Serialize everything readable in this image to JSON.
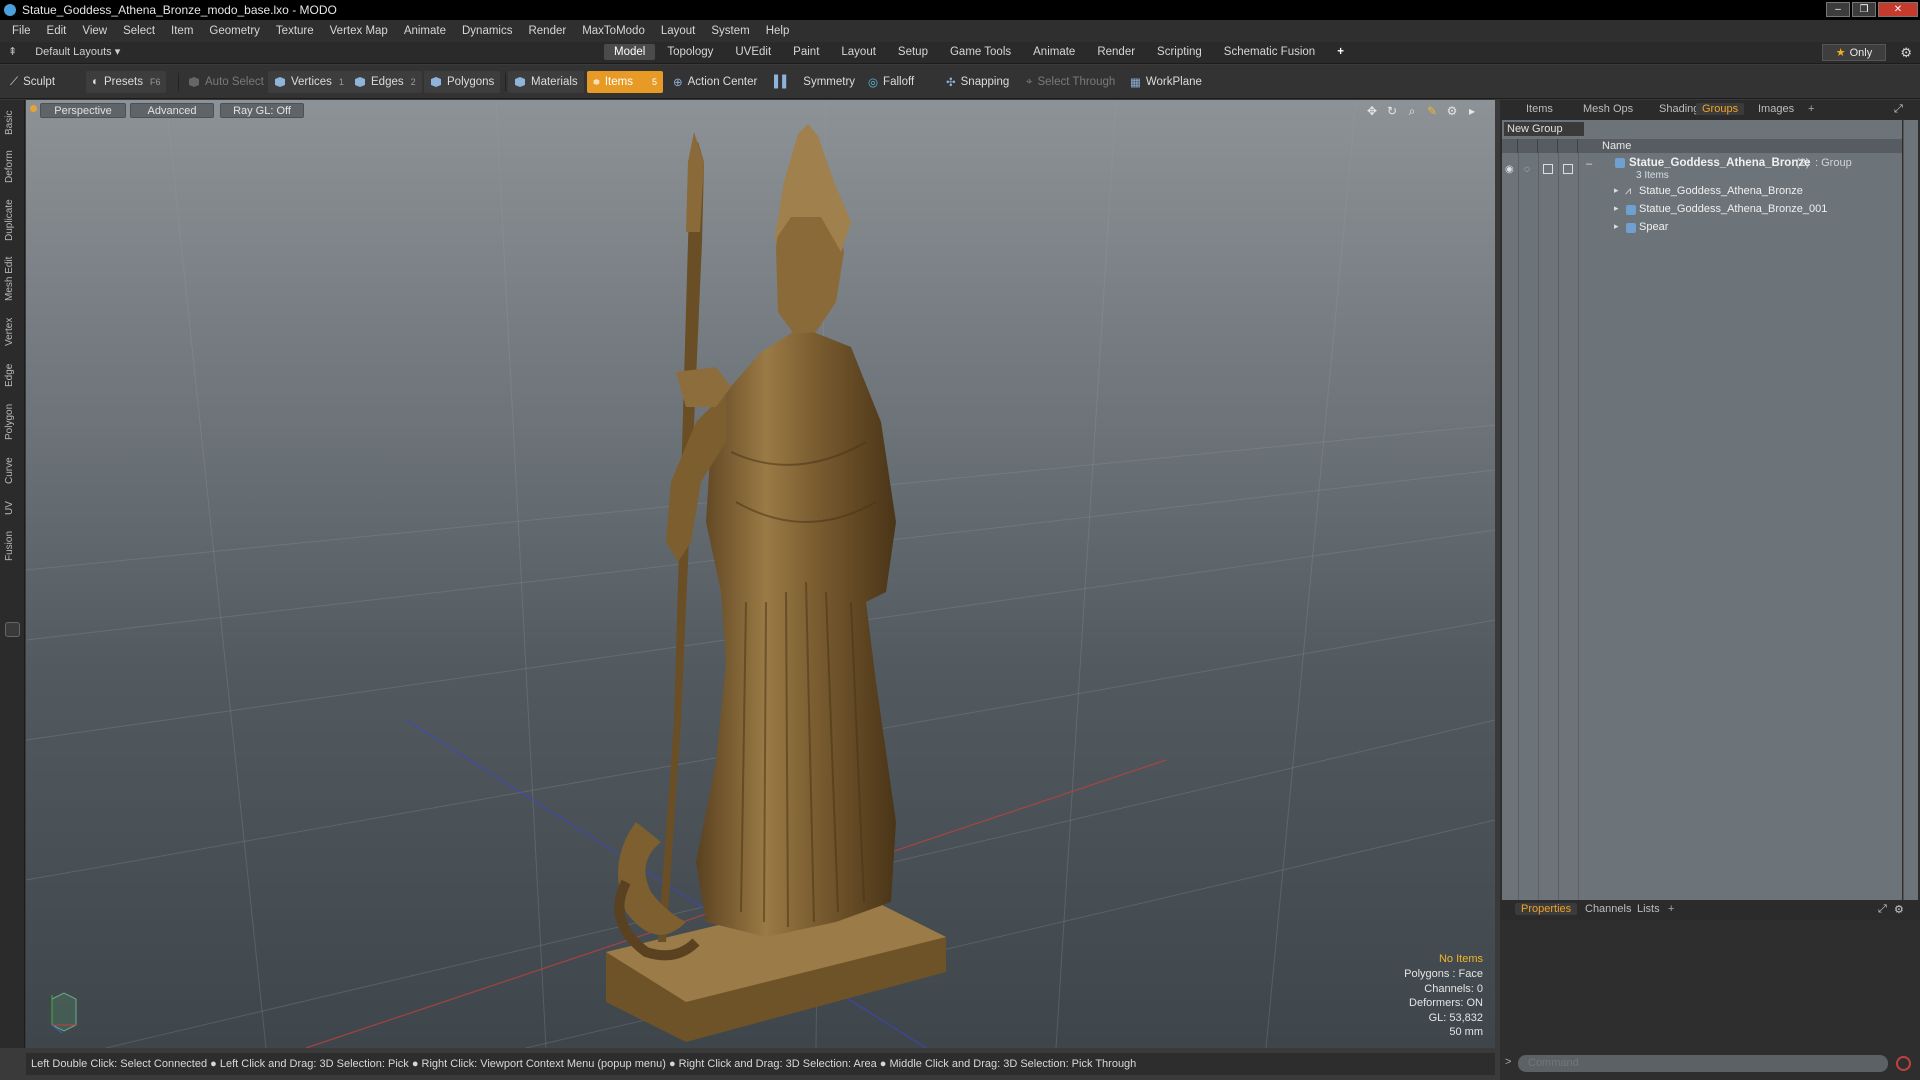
{
  "window": {
    "title": "Statue_Goddess_Athena_Bronze_modo_base.lxo - MODO",
    "buttons": {
      "minimize": "–",
      "maximize": "❐",
      "close": "✕"
    }
  },
  "menubar": [
    "File",
    "Edit",
    "View",
    "Select",
    "Item",
    "Geometry",
    "Texture",
    "Vertex Map",
    "Animate",
    "Dynamics",
    "Render",
    "MaxToModo",
    "Layout",
    "System",
    "Help"
  ],
  "layouts": {
    "default_label": "Default Layouts ▾",
    "tabs": [
      "Model",
      "Topology",
      "UVEdit",
      "Paint",
      "Layout",
      "Setup",
      "Game Tools",
      "Animate",
      "Render",
      "Scripting",
      "Schematic Fusion"
    ],
    "active_tab": "Model",
    "add": "+",
    "only_label": "Only"
  },
  "toolbar": {
    "sculpt": "Sculpt",
    "presets": "Presets",
    "presets_key": "F6",
    "auto_select": "Auto Select",
    "vertices": "Vertices",
    "vertices_count": "1",
    "edges": "Edges",
    "edges_count": "2",
    "polygons": "Polygons",
    "materials": "Materials",
    "items": "Items",
    "items_count": "5",
    "action_center": "Action Center",
    "symmetry": "Symmetry",
    "falloff": "Falloff",
    "snapping": "Snapping",
    "select_through": "Select Through",
    "workplane": "WorkPlane"
  },
  "left_tabs": [
    "Basic",
    "Deform",
    "Duplicate",
    "Mesh Edit",
    "Vertex",
    "Edge",
    "Polygon",
    "Curve",
    "UV",
    "Fusion"
  ],
  "viewport": {
    "perspective": "Perspective",
    "advanced": "Advanced",
    "raygl": "Ray GL: Off",
    "stats": {
      "no_items": "No Items",
      "polygons": "Polygons : Face",
      "channels": "Channels: 0",
      "deformers": "Deformers: ON",
      "gl": "GL: 53,832",
      "focal": "50 mm"
    },
    "colors": {
      "bronze": "#8a6a3a",
      "accent": "#f0b42a"
    }
  },
  "statusbar": "Left Double Click: Select Connected ● Left Click and Drag: 3D Selection: Pick ● Right Click: Viewport Context Menu (popup menu) ● Right Click and Drag: 3D Selection: Area ● Middle Click and Drag: 3D Selection: Pick Through",
  "right_panel": {
    "top_tabs": [
      "Items",
      "Mesh Ops",
      "Shading",
      "Groups",
      "Images"
    ],
    "active_top_tab": "Groups",
    "new_group": "New Group",
    "column_name": "Name",
    "tree": {
      "group_name": "Statue_Goddess_Athena_Bronze",
      "group_count": "(2)",
      "group_type": ": Group",
      "group_sub": "3 Items",
      "children": [
        "Statue_Goddess_Athena_Bronze",
        "Statue_Goddess_Athena_Bronze_001",
        "Spear"
      ]
    },
    "bottom_tabs": [
      "Properties",
      "Channels",
      "Lists"
    ],
    "active_bottom_tab": "Properties",
    "command_placeholder": "Command"
  }
}
